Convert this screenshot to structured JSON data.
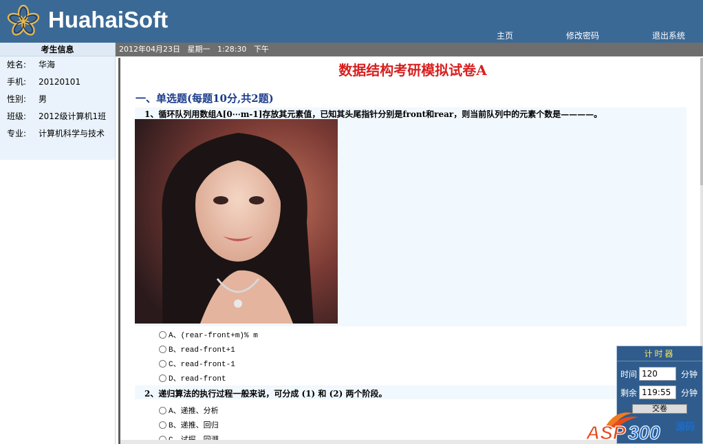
{
  "header": {
    "logo_text": "HuahaiSoft",
    "nav": {
      "home": "主页",
      "change_password": "修改密码",
      "logout": "退出系统"
    }
  },
  "sidebar": {
    "title": "考生信息",
    "rows": [
      {
        "label": "姓名:",
        "value": "华海"
      },
      {
        "label": "手机:",
        "value": "20120101"
      },
      {
        "label": "性别:",
        "value": "男"
      },
      {
        "label": "班级:",
        "value": "2012级计算机1班"
      },
      {
        "label": "专业:",
        "value": "计算机科学与技术"
      }
    ]
  },
  "datebar": {
    "date": "2012年04月23日",
    "weekday": "星期一",
    "time": "1:28:30",
    "ampm": "下午"
  },
  "exam": {
    "title": "数据结构考研模拟试卷A",
    "section_heading": "一、单选题(每题10分,共2题)",
    "questions": [
      {
        "text": "1、循环队列用数组A[0⋯m-1]存放其元素值，已知其头尾指针分别是front和rear，则当前队列中的元素个数是————。",
        "options": [
          "A、(rear-front+m)% m",
          "B、read-front+1",
          "C、read-front-1",
          "D、read-front"
        ]
      },
      {
        "text": "2、递归算法的执行过程一般来说，可分成 (1) 和 (2) 两个阶段。",
        "options": [
          "A、递推、分析",
          "B、递推、回归",
          "C、试探、回溯"
        ]
      }
    ]
  },
  "timer": {
    "title": "计时器",
    "time_label": "时间",
    "time_value": "120",
    "time_unit": "分钟",
    "remain_label": "剩余",
    "remain_value": "119:55",
    "remain_unit": "分钟",
    "button_label": "交卷"
  },
  "watermark": {
    "text": "ASP300",
    "suffix": "源码"
  },
  "colors": {
    "header_bg": "#3b6996",
    "title_red": "#d71f1f",
    "section_blue": "#1a3c8c",
    "timer_bg": "#2f5c8c",
    "timer_title": "#f3e35e"
  }
}
